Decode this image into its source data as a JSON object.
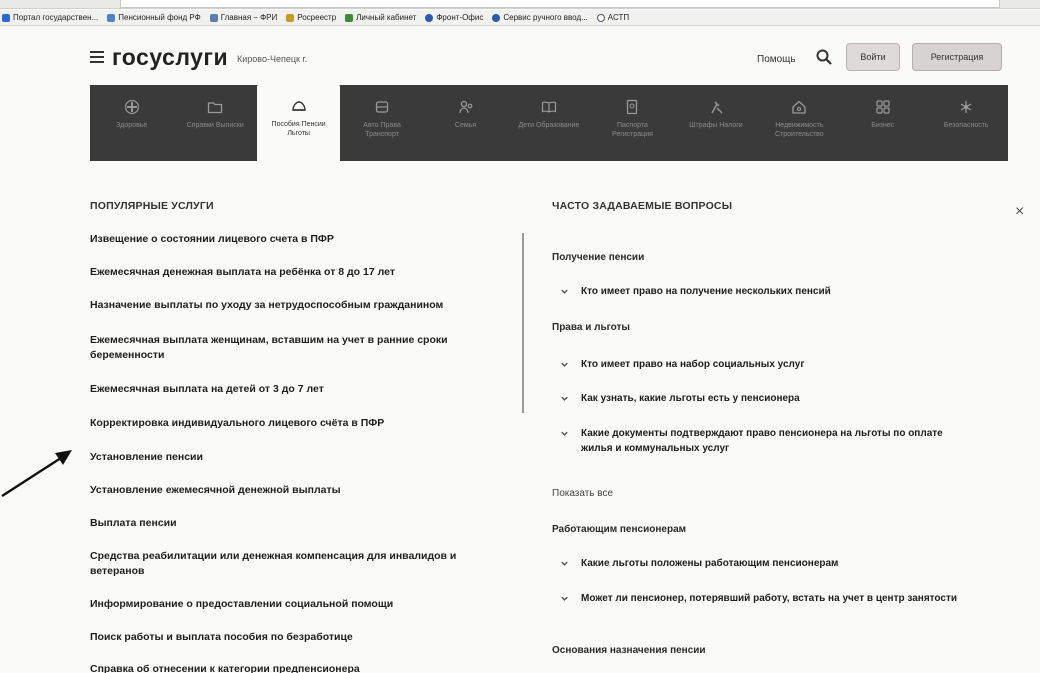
{
  "bookmarks": [
    {
      "label": "Портал государствен...",
      "color": "#2a6ad8"
    },
    {
      "label": "Пенсионный фонд РФ",
      "color": "#4a86c8"
    },
    {
      "label": "Главная – ФРИ",
      "color": "#5a7fb0"
    },
    {
      "label": "Росреестр",
      "color": "#c89a28"
    },
    {
      "label": "Личный кабинет",
      "color": "#3c8a3c"
    },
    {
      "label": "Фронт-Офис",
      "color": "#2a5aa8"
    },
    {
      "label": "Сервис ручного ввод...",
      "color": "#2a5aa8"
    },
    {
      "label": "АСТП",
      "color": "#555555"
    }
  ],
  "header": {
    "logo": "госуслуги",
    "city": "Кирово-Чепецк г.",
    "help": "Помощь",
    "login": "Войти",
    "register": "Регистрация"
  },
  "categories": [
    {
      "label": "Здоровье",
      "icon": "health-icon"
    },
    {
      "label": "Справки Выписки",
      "icon": "folder-icon"
    },
    {
      "label": "Пособия Пенсии Льготы",
      "icon": "benefits-icon",
      "active": true
    },
    {
      "label": "Авто Права Транспорт",
      "icon": "car-icon"
    },
    {
      "label": "Семья",
      "icon": "family-icon"
    },
    {
      "label": "Дети Образование",
      "icon": "book-icon"
    },
    {
      "label": "Паспорта Регистрация",
      "icon": "passport-icon"
    },
    {
      "label": "Штрафы Налоги",
      "icon": "fines-icon"
    },
    {
      "label": "Недвижимость Строительство",
      "icon": "house-icon"
    },
    {
      "label": "Бизнес",
      "icon": "business-icon"
    },
    {
      "label": "Безопасность",
      "icon": "security-icon"
    }
  ],
  "popular": {
    "title": "ПОПУЛЯРНЫЕ УСЛУГИ",
    "items": [
      "Извещение о состоянии лицевого счета в ПФР",
      "Ежемесячная денежная выплата на ребёнка от 8 до 17 лет",
      "Назначение выплаты по уходу за нетрудоспособным гражданином",
      "Ежемесячная выплата женщинам, вставшим на учет в ранние сроки беременности",
      "Ежемесячная выплата на детей от 3 до 7 лет",
      "Корректировка индивидуального лицевого счёта в ПФР",
      "Установление пенсии",
      "Установление ежемесячной денежной выплаты",
      "Выплата пенсии",
      "Средства реабилитации или денежная компенсация для инвалидов и ветеранов",
      "Информирование о предоставлении социальной помощи",
      "Поиск работы и выплата пособия по безработице",
      "Справка об отнесении к категории предпенсионера"
    ]
  },
  "faq": {
    "title": "ЧАСТО ЗАДАВАЕМЫЕ ВОПРОСЫ",
    "cat1": "Получение пенсии",
    "q1": "Кто имеет право на получение нескольких пенсий",
    "cat2": "Права и льготы",
    "q2": "Кто имеет право на набор социальных услуг",
    "q3": "Как узнать, какие льготы есть у пенсионера",
    "q4": "Какие документы подтверждают право пенсионера на льготы по оплате жилья и коммунальных услуг",
    "show_all": "Показать все",
    "cat3": "Работающим пенсионерам",
    "q5": "Какие льготы положены работающим пенсионерам",
    "q6": "Может ли пенсионер, потерявший работу, встать на учет в центр занятости",
    "cat4": "Основания назначения пенсии"
  },
  "close_symbol": "×"
}
